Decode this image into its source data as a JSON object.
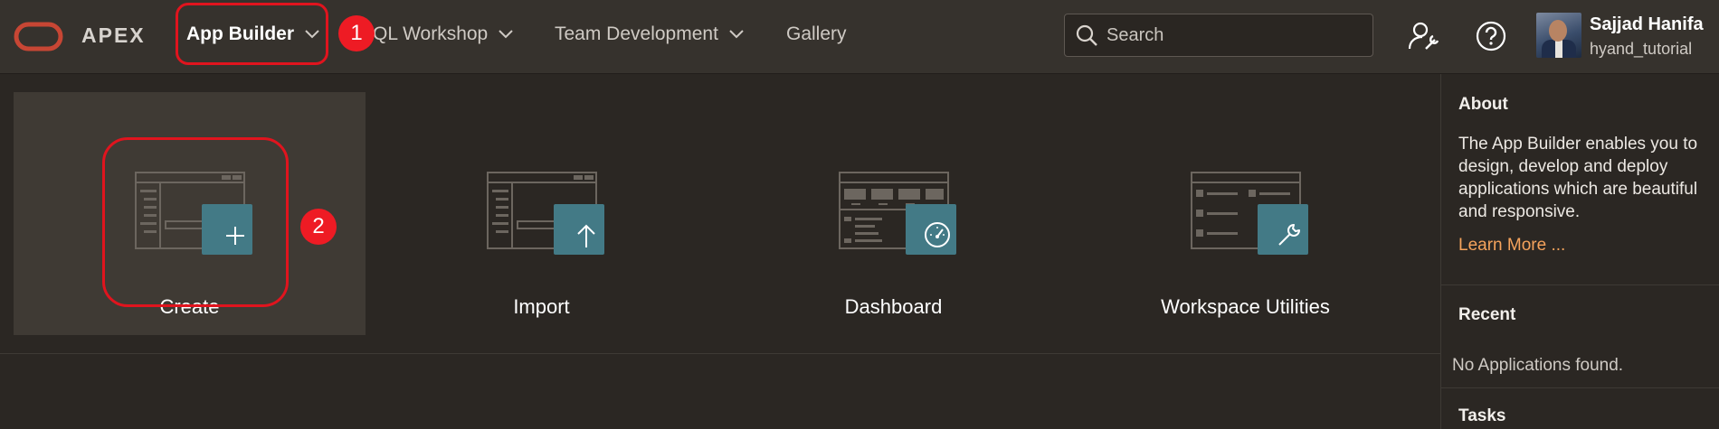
{
  "header": {
    "brand": "APEX",
    "nav": [
      {
        "label": "App Builder",
        "active": true,
        "dropdown": true
      },
      {
        "label": "SQL Workshop",
        "active": false,
        "dropdown": true
      },
      {
        "label": "Team Development",
        "active": false,
        "dropdown": true
      },
      {
        "label": "Gallery",
        "active": false,
        "dropdown": false
      }
    ],
    "search": {
      "placeholder": "Search",
      "value": ""
    },
    "icons": [
      "administration-icon",
      "help-icon"
    ],
    "user": {
      "name": "Sajjad Hanifa",
      "workspace": "hyand_tutorial"
    }
  },
  "tiles": [
    {
      "label": "Create",
      "icon": "plus-icon"
    },
    {
      "label": "Import",
      "icon": "arrow-up-icon"
    },
    {
      "label": "Dashboard",
      "icon": "gauge-icon"
    },
    {
      "label": "Workspace Utilities",
      "icon": "wrench-icon"
    }
  ],
  "sidebar": {
    "about_title": "About",
    "about_text": "The App Builder enables you to design, develop and deploy applications which are beautiful and responsive.",
    "learn_more": "Learn More ...",
    "recent_title": "Recent",
    "recent_empty": "No Applications found.",
    "tasks_title": "Tasks"
  },
  "callouts": [
    "1",
    "2"
  ],
  "colors": {
    "accent": "#437a86",
    "highlight": "#e0141e",
    "link": "#f5a35c",
    "logo": "#c74634"
  }
}
